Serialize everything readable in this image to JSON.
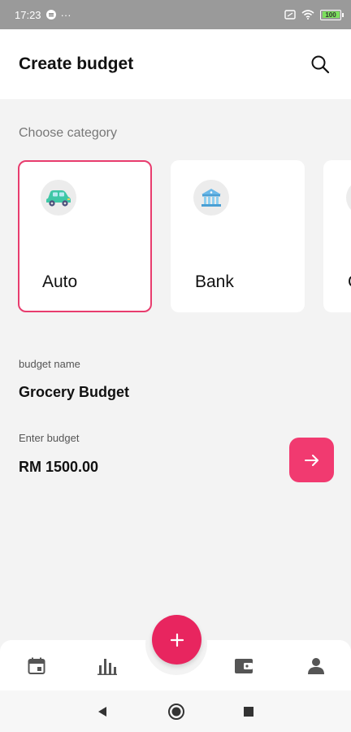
{
  "status_bar": {
    "time": "17:23",
    "dots": "···",
    "battery": "100"
  },
  "header": {
    "title": "Create budget"
  },
  "categories": {
    "label": "Choose category",
    "items": [
      {
        "label": "Auto",
        "icon": "car-icon",
        "selected": true
      },
      {
        "label": "Bank",
        "icon": "bank-icon",
        "selected": false
      },
      {
        "label": "C",
        "icon": "category-icon",
        "selected": false
      }
    ]
  },
  "form": {
    "name_label": "budget name",
    "name_value": "Grocery Budget",
    "amount_label": "Enter budget",
    "amount_value": "RM 1500.00"
  },
  "bottom_nav": {
    "items": [
      "calendar-icon",
      "bar-chart-icon",
      "wallet-icon",
      "profile-icon"
    ],
    "fab_icon": "plus-icon"
  },
  "colors": {
    "accent": "#e8255f",
    "selected_border": "#e83c6e",
    "background": "#f3f3f3"
  }
}
